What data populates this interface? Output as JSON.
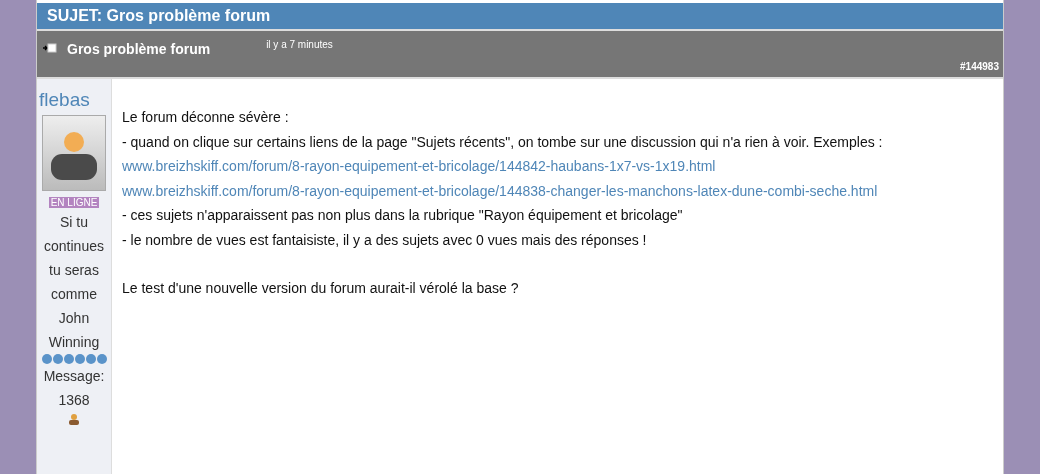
{
  "topic_bar": {
    "title": "SUJET: Gros problème forum"
  },
  "post": {
    "title": "Gros problème forum",
    "time": "il y a 7 minutes",
    "number": "#144983",
    "author": {
      "name": "flebas",
      "status": "EN LIGNE",
      "signature": "Si tu continues tu seras comme John Winning",
      "messages_label": "Message:",
      "messages_count": "1368"
    },
    "body": [
      {
        "kind": "text",
        "text": "Le forum déconne sévère :"
      },
      {
        "kind": "text",
        "text": "- quand on clique sur certains liens de la page \"Sujets récents\", on tombe sur une discussion qui n'a rien à voir. Exemples :"
      },
      {
        "kind": "link",
        "text": "www.breizhskiff.com/forum/8-rayon-equipement-et-bricolage/144842-haubans-1x7-vs-1x19.html"
      },
      {
        "kind": "link",
        "text": "www.breizhskiff.com/forum/8-rayon-equipement-et-bricolage/144838-changer-les-manchons-latex-dune-combi-seche.html"
      },
      {
        "kind": "text",
        "text": "- ces sujets n'apparaissent pas non plus dans la rubrique \"Rayon équipement et bricolage\""
      },
      {
        "kind": "text",
        "text": "- le nombre de vues est fantaisiste, il y a des sujets avec 0 vues mais des réponses !"
      }
    ],
    "closing": "Le test d'une nouvelle version du forum aurait-il vérolé la base ?"
  }
}
